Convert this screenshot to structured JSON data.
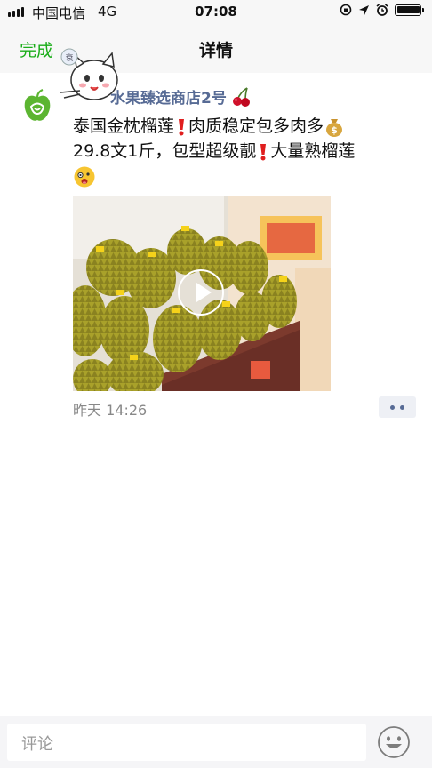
{
  "status_bar": {
    "carrier": "中国电信",
    "network": "4G",
    "time": "07:08"
  },
  "nav": {
    "done_label": "完成",
    "title": "详情"
  },
  "post": {
    "username": "水果臻选商店2号",
    "text_line1": "泰国金枕榴莲",
    "text_part2": "肉质稳定包多肉多",
    "text_part3": "29.8文1斤，包型超级靓",
    "text_part4": "大量熟榴莲",
    "timestamp": "昨天 14:26"
  },
  "comment": {
    "placeholder": "评论"
  },
  "colors": {
    "accent_green": "#1aad19",
    "link_blue": "#576b95"
  },
  "icons": [
    "signal-icon",
    "orientation-lock-icon",
    "location-arrow-icon",
    "alarm-icon",
    "battery-icon",
    "apple-avatar-icon",
    "cherry-icon",
    "exclamation-icon",
    "money-bag-icon",
    "face-emoji-icon",
    "play-icon",
    "more-dots-icon",
    "smiley-icon"
  ]
}
